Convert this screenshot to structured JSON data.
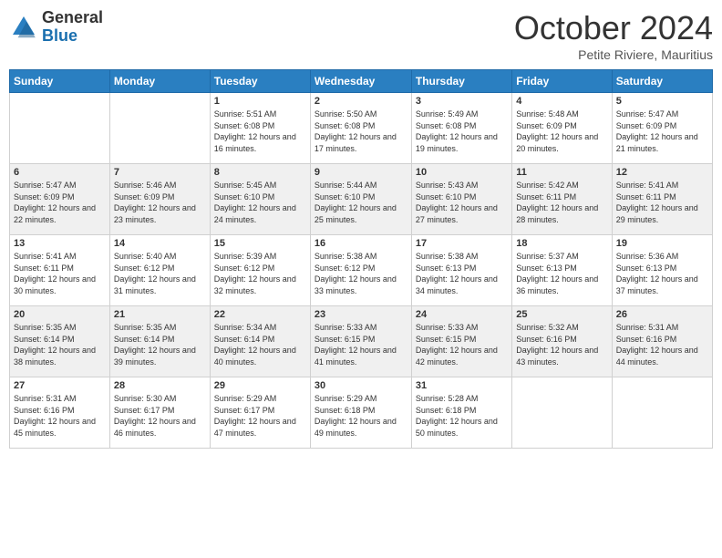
{
  "logo": {
    "general": "General",
    "blue": "Blue"
  },
  "header": {
    "month": "October 2024",
    "location": "Petite Riviere, Mauritius"
  },
  "weekdays": [
    "Sunday",
    "Monday",
    "Tuesday",
    "Wednesday",
    "Thursday",
    "Friday",
    "Saturday"
  ],
  "weeks": [
    [
      {
        "day": "",
        "sunrise": "",
        "sunset": "",
        "daylight": ""
      },
      {
        "day": "",
        "sunrise": "",
        "sunset": "",
        "daylight": ""
      },
      {
        "day": "1",
        "sunrise": "Sunrise: 5:51 AM",
        "sunset": "Sunset: 6:08 PM",
        "daylight": "Daylight: 12 hours and 16 minutes."
      },
      {
        "day": "2",
        "sunrise": "Sunrise: 5:50 AM",
        "sunset": "Sunset: 6:08 PM",
        "daylight": "Daylight: 12 hours and 17 minutes."
      },
      {
        "day": "3",
        "sunrise": "Sunrise: 5:49 AM",
        "sunset": "Sunset: 6:08 PM",
        "daylight": "Daylight: 12 hours and 19 minutes."
      },
      {
        "day": "4",
        "sunrise": "Sunrise: 5:48 AM",
        "sunset": "Sunset: 6:09 PM",
        "daylight": "Daylight: 12 hours and 20 minutes."
      },
      {
        "day": "5",
        "sunrise": "Sunrise: 5:47 AM",
        "sunset": "Sunset: 6:09 PM",
        "daylight": "Daylight: 12 hours and 21 minutes."
      }
    ],
    [
      {
        "day": "6",
        "sunrise": "Sunrise: 5:47 AM",
        "sunset": "Sunset: 6:09 PM",
        "daylight": "Daylight: 12 hours and 22 minutes."
      },
      {
        "day": "7",
        "sunrise": "Sunrise: 5:46 AM",
        "sunset": "Sunset: 6:09 PM",
        "daylight": "Daylight: 12 hours and 23 minutes."
      },
      {
        "day": "8",
        "sunrise": "Sunrise: 5:45 AM",
        "sunset": "Sunset: 6:10 PM",
        "daylight": "Daylight: 12 hours and 24 minutes."
      },
      {
        "day": "9",
        "sunrise": "Sunrise: 5:44 AM",
        "sunset": "Sunset: 6:10 PM",
        "daylight": "Daylight: 12 hours and 25 minutes."
      },
      {
        "day": "10",
        "sunrise": "Sunrise: 5:43 AM",
        "sunset": "Sunset: 6:10 PM",
        "daylight": "Daylight: 12 hours and 27 minutes."
      },
      {
        "day": "11",
        "sunrise": "Sunrise: 5:42 AM",
        "sunset": "Sunset: 6:11 PM",
        "daylight": "Daylight: 12 hours and 28 minutes."
      },
      {
        "day": "12",
        "sunrise": "Sunrise: 5:41 AM",
        "sunset": "Sunset: 6:11 PM",
        "daylight": "Daylight: 12 hours and 29 minutes."
      }
    ],
    [
      {
        "day": "13",
        "sunrise": "Sunrise: 5:41 AM",
        "sunset": "Sunset: 6:11 PM",
        "daylight": "Daylight: 12 hours and 30 minutes."
      },
      {
        "day": "14",
        "sunrise": "Sunrise: 5:40 AM",
        "sunset": "Sunset: 6:12 PM",
        "daylight": "Daylight: 12 hours and 31 minutes."
      },
      {
        "day": "15",
        "sunrise": "Sunrise: 5:39 AM",
        "sunset": "Sunset: 6:12 PM",
        "daylight": "Daylight: 12 hours and 32 minutes."
      },
      {
        "day": "16",
        "sunrise": "Sunrise: 5:38 AM",
        "sunset": "Sunset: 6:12 PM",
        "daylight": "Daylight: 12 hours and 33 minutes."
      },
      {
        "day": "17",
        "sunrise": "Sunrise: 5:38 AM",
        "sunset": "Sunset: 6:13 PM",
        "daylight": "Daylight: 12 hours and 34 minutes."
      },
      {
        "day": "18",
        "sunrise": "Sunrise: 5:37 AM",
        "sunset": "Sunset: 6:13 PM",
        "daylight": "Daylight: 12 hours and 36 minutes."
      },
      {
        "day": "19",
        "sunrise": "Sunrise: 5:36 AM",
        "sunset": "Sunset: 6:13 PM",
        "daylight": "Daylight: 12 hours and 37 minutes."
      }
    ],
    [
      {
        "day": "20",
        "sunrise": "Sunrise: 5:35 AM",
        "sunset": "Sunset: 6:14 PM",
        "daylight": "Daylight: 12 hours and 38 minutes."
      },
      {
        "day": "21",
        "sunrise": "Sunrise: 5:35 AM",
        "sunset": "Sunset: 6:14 PM",
        "daylight": "Daylight: 12 hours and 39 minutes."
      },
      {
        "day": "22",
        "sunrise": "Sunrise: 5:34 AM",
        "sunset": "Sunset: 6:14 PM",
        "daylight": "Daylight: 12 hours and 40 minutes."
      },
      {
        "day": "23",
        "sunrise": "Sunrise: 5:33 AM",
        "sunset": "Sunset: 6:15 PM",
        "daylight": "Daylight: 12 hours and 41 minutes."
      },
      {
        "day": "24",
        "sunrise": "Sunrise: 5:33 AM",
        "sunset": "Sunset: 6:15 PM",
        "daylight": "Daylight: 12 hours and 42 minutes."
      },
      {
        "day": "25",
        "sunrise": "Sunrise: 5:32 AM",
        "sunset": "Sunset: 6:16 PM",
        "daylight": "Daylight: 12 hours and 43 minutes."
      },
      {
        "day": "26",
        "sunrise": "Sunrise: 5:31 AM",
        "sunset": "Sunset: 6:16 PM",
        "daylight": "Daylight: 12 hours and 44 minutes."
      }
    ],
    [
      {
        "day": "27",
        "sunrise": "Sunrise: 5:31 AM",
        "sunset": "Sunset: 6:16 PM",
        "daylight": "Daylight: 12 hours and 45 minutes."
      },
      {
        "day": "28",
        "sunrise": "Sunrise: 5:30 AM",
        "sunset": "Sunset: 6:17 PM",
        "daylight": "Daylight: 12 hours and 46 minutes."
      },
      {
        "day": "29",
        "sunrise": "Sunrise: 5:29 AM",
        "sunset": "Sunset: 6:17 PM",
        "daylight": "Daylight: 12 hours and 47 minutes."
      },
      {
        "day": "30",
        "sunrise": "Sunrise: 5:29 AM",
        "sunset": "Sunset: 6:18 PM",
        "daylight": "Daylight: 12 hours and 49 minutes."
      },
      {
        "day": "31",
        "sunrise": "Sunrise: 5:28 AM",
        "sunset": "Sunset: 6:18 PM",
        "daylight": "Daylight: 12 hours and 50 minutes."
      },
      {
        "day": "",
        "sunrise": "",
        "sunset": "",
        "daylight": ""
      },
      {
        "day": "",
        "sunrise": "",
        "sunset": "",
        "daylight": ""
      }
    ]
  ]
}
